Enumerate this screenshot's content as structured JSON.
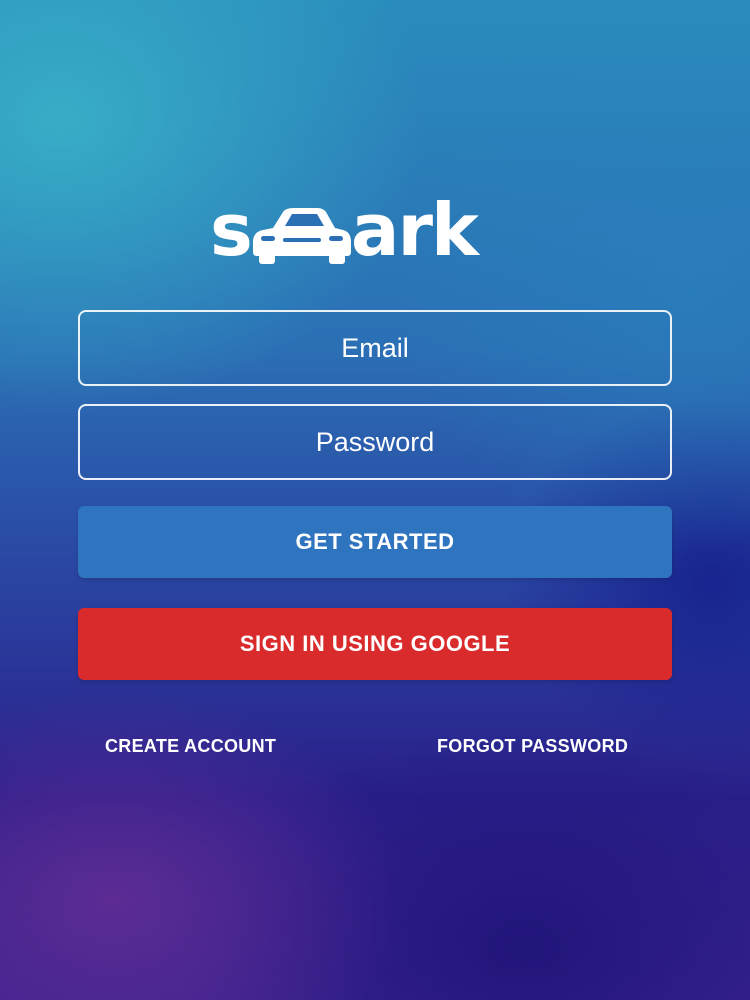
{
  "app": {
    "logo": {
      "prefix": "s",
      "icon": "car-icon",
      "suffix": "ark"
    }
  },
  "login_form": {
    "email": {
      "placeholder": "Email",
      "value": ""
    },
    "password": {
      "placeholder": "Password",
      "value": ""
    },
    "get_started_label": "GET STARTED",
    "google_signin_label": "SIGN IN USING GOOGLE"
  },
  "links": {
    "create_account": "CREATE ACCOUNT",
    "forgot_password": "FORGOT PASSWORD"
  },
  "colors": {
    "primary_button": "#2f74be",
    "google_button": "#d92a2c",
    "text": "#ffffff"
  }
}
